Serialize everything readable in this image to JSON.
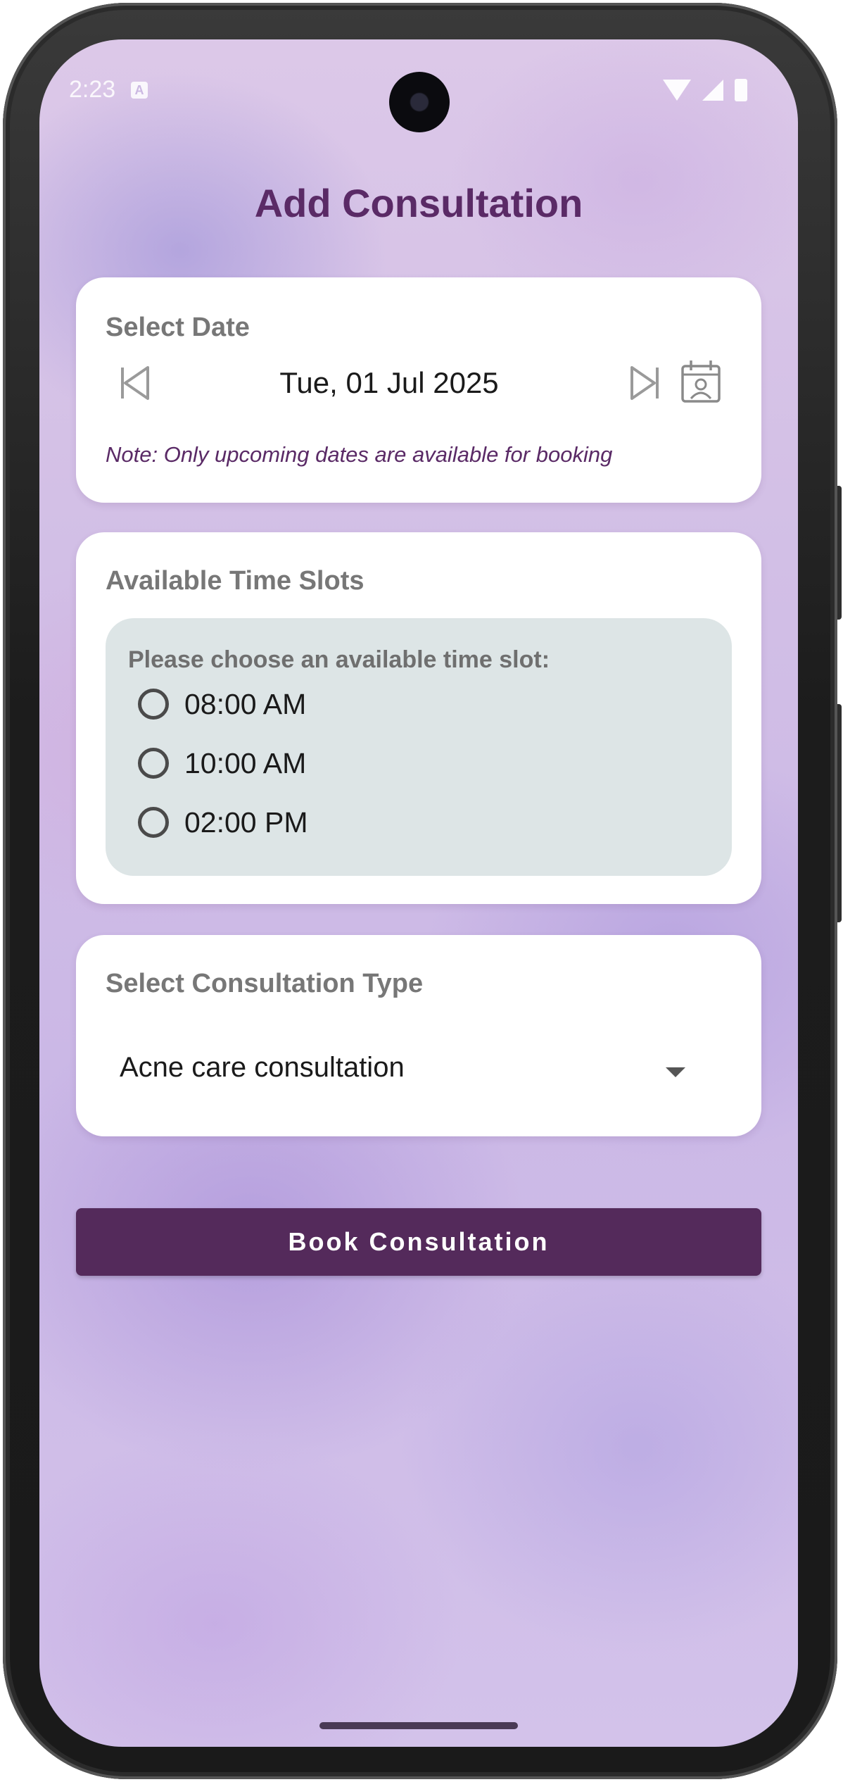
{
  "status_bar": {
    "time": "2:23",
    "notification_glyph": "A"
  },
  "page": {
    "title": "Add Consultation"
  },
  "date_card": {
    "title": "Select Date",
    "date": "Tue, 01 Jul 2025",
    "note": "Note: Only upcoming dates are available for booking",
    "icons": [
      "skip-previous-icon",
      "skip-next-icon",
      "calendar-icon"
    ]
  },
  "slots_card": {
    "title": "Available Time Slots",
    "prompt": "Please choose an available time slot:",
    "slots": [
      {
        "label": "08:00 AM",
        "selected": false
      },
      {
        "label": "10:00 AM",
        "selected": false
      },
      {
        "label": "02:00 PM",
        "selected": false
      }
    ]
  },
  "type_card": {
    "title": "Select Consultation Type",
    "selected_value": "Acne care consultation"
  },
  "actions": {
    "book_label": "Book Consultation"
  },
  "colors": {
    "brand": "#542a5b",
    "title": "#5a2a66",
    "slot_box": "#dde5e6"
  }
}
